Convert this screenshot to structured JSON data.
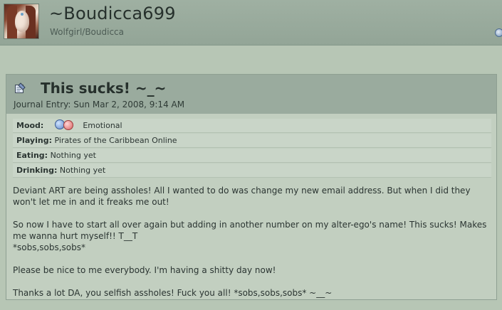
{
  "profile": {
    "username": "~Boudicca699",
    "subtitle": "Wolfgirl/Boudicca",
    "avatar_icon": "elf-girl-avatar"
  },
  "entry": {
    "title": "This sucks! ~_~",
    "date": "Journal Entry: Sun Mar 2, 2008, 9:14 AM",
    "icon": "journal-icon"
  },
  "meta": {
    "mood_label": "Mood:",
    "mood_value": "Emotional",
    "playing_label": "Playing:",
    "playing_value": "Pirates of the Caribbean Online",
    "eating_label": "Eating:",
    "eating_value": "Nothing yet",
    "drinking_label": "Drinking:",
    "drinking_value": "Nothing yet"
  },
  "body": {
    "p1": "Deviant ART are being assholes! All I wanted to do was change my new email address. But when I did they won't let me in and it freaks me out!",
    "p2": "So now I have to start all over again but adding in another number on my alter-ego's name! This sucks! Makes me wanna hurt myself!! T__T\n*sobs,sobs,sobs*",
    "p3": "Please be nice to me everybody. I'm having a shitty day now!",
    "p4": "Thanks a lot DA, you selfish assholes! Fuck you all! *sobs,sobs,sobs* ~__~"
  },
  "colors": {
    "page_bg": "#b7c6b5",
    "header_bg": "#9fb0a2",
    "panel_head_bg": "#9aab9e",
    "text": "#2b3532"
  }
}
